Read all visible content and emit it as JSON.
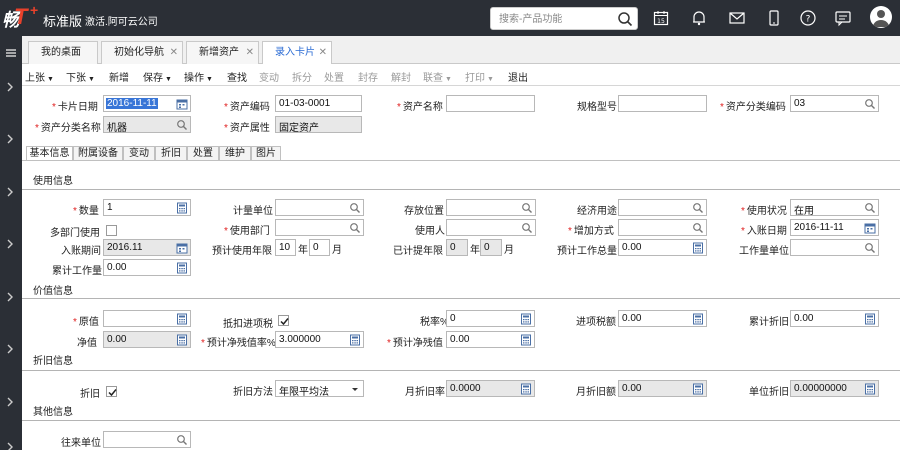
{
  "app": {
    "logo_mark": "畅",
    "logo_t": "T",
    "logo_plus": "+",
    "edition": "标准版",
    "activate_text": "激活.阿可云公司",
    "search_placeholder": "搜索-产品功能"
  },
  "tabs": [
    {
      "label": "我的桌面",
      "closable": false,
      "active": false
    },
    {
      "label": "初始化导航",
      "closable": true,
      "active": false
    },
    {
      "label": "新增资产",
      "closable": true,
      "active": false
    },
    {
      "label": "录入卡片",
      "closable": true,
      "active": true
    }
  ],
  "toolbar": {
    "prev": "上张",
    "next": "下张",
    "new": "新增",
    "save": "保存",
    "operate": "操作",
    "find": "查找",
    "change": "变动",
    "split": "拆分",
    "dispose": "处置",
    "seal": "封存",
    "unseal": "解封",
    "query": "联查",
    "print": "打印",
    "exit": "退出"
  },
  "header": {
    "card_date_label": "卡片日期",
    "card_date": "2016-11-11",
    "asset_code_label": "资产编码",
    "asset_code": "01-03-0001",
    "asset_name_label": "资产名称",
    "asset_name": "",
    "spec_label": "规格型号",
    "spec": "",
    "class_code_label": "资产分类编码",
    "class_code": "03",
    "class_name_label": "资产分类名称",
    "class_name": "机器",
    "attr_label": "资产属性",
    "attr": "固定资产"
  },
  "inner_tabs": [
    "基本信息",
    "附属设备",
    "变动",
    "折旧",
    "处置",
    "维护",
    "图片"
  ],
  "usage": {
    "section": "使用信息",
    "qty_label": "数量",
    "qty": "1",
    "unit_label": "计量单位",
    "unit": "",
    "location_label": "存放位置",
    "location": "",
    "purpose_label": "经济用途",
    "purpose": "",
    "status_label": "使用状况",
    "status": "在用",
    "multi_dept_label": "多部门使用",
    "dept_label": "使用部门",
    "dept": "",
    "user_label": "使用人",
    "user": "",
    "add_method_label": "增加方式",
    "add_method": "",
    "entry_date_label": "入账日期",
    "entry_date": "2016-11-11",
    "entry_period_label": "入账期间",
    "entry_period": "2016.11",
    "life_label": "预计使用年限",
    "life_years": "10",
    "year_unit": "年",
    "life_months": "0",
    "month_unit": "月",
    "accrued_label": "已计提年限",
    "accrued_years": "0",
    "accrued_months": "0",
    "est_workload_label": "预计工作总量",
    "est_workload": "0.00",
    "workload_unit_label": "工作量单位",
    "workload_unit": "",
    "accum_workload_label": "累计工作量",
    "accum_workload": "0.00"
  },
  "value": {
    "section": "价值信息",
    "orig_label": "原值",
    "orig": "",
    "deduct_label": "抵扣进项税",
    "tax_rate_label": "税率%",
    "tax_rate": "0",
    "input_tax_label": "进项税额",
    "input_tax": "0.00",
    "accum_dep_label": "累计折旧",
    "accum_dep": "0.00",
    "net_label": "净值",
    "net": "0.00",
    "salvage_rate_label": "预计净残值率%",
    "salvage_rate": "3.000000",
    "salvage_label": "预计净残值",
    "salvage": "0.00"
  },
  "depreciation": {
    "section": "折旧信息",
    "dep_label": "折旧",
    "method_label": "折旧方法",
    "method": "年限平均法",
    "monthly_rate_label": "月折旧率",
    "monthly_rate": "0.0000",
    "monthly_amt_label": "月折旧额",
    "monthly_amt": "0.00",
    "unit_dep_label": "单位折旧",
    "unit_dep": "0.00000000"
  },
  "other": {
    "section": "其他信息",
    "partner_label": "往来单位",
    "partner": ""
  },
  "colors": {
    "topbar": "#2b2f36",
    "accent": "#2a6bd4",
    "required": "#e02020",
    "logo": "#e8412b"
  }
}
